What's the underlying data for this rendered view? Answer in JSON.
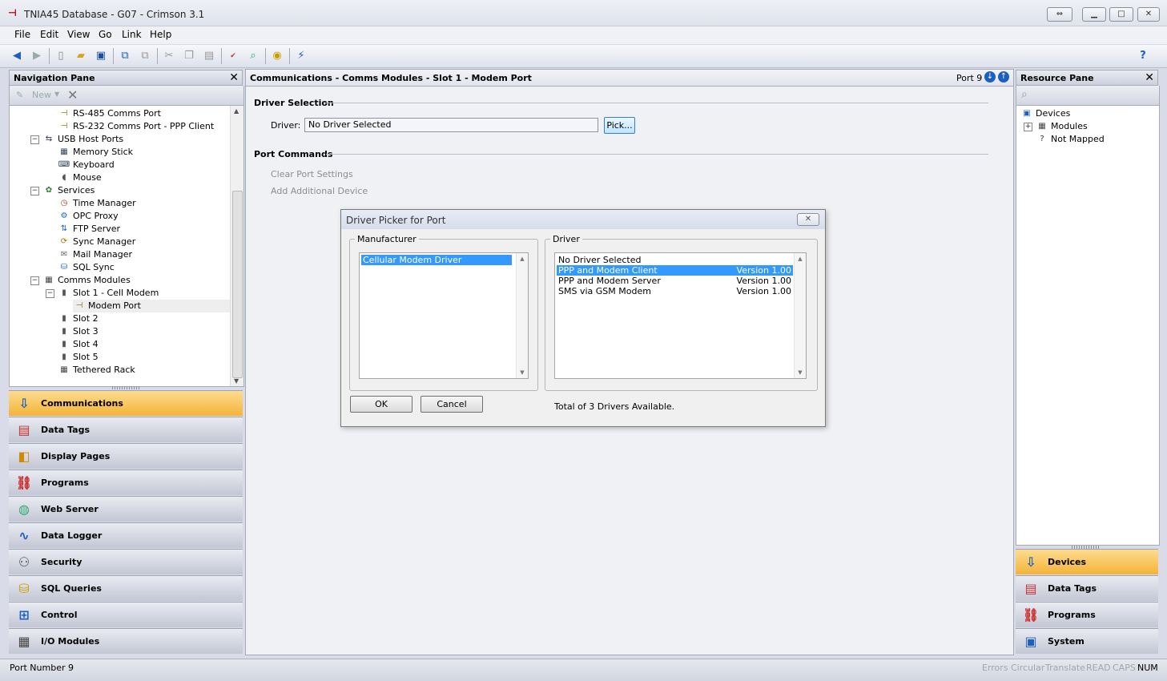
{
  "window": {
    "title": "TNIA45 Database - G07 - Crimson 3.1",
    "app_icon": "crimson-app-icon",
    "buttons": {
      "restore_alt": "⇔",
      "minimize": "▁",
      "maximize": "□",
      "close": "✕"
    }
  },
  "menu": [
    "File",
    "Edit",
    "View",
    "Go",
    "Link",
    "Help"
  ],
  "toolbar": {
    "icons": [
      "back-icon",
      "forward-icon",
      "new-file-icon",
      "open-folder-icon",
      "save-icon",
      "import-icon",
      "export-icon",
      "cut-icon",
      "copy-icon",
      "paste-icon",
      "check-spelling-icon",
      "find-icon",
      "translate-icon",
      "link-icon",
      "help-icon"
    ]
  },
  "nav": {
    "title": "Navigation Pane",
    "new_label": "New",
    "tree": [
      {
        "label": "RS-485 Comms Port",
        "indent": 2,
        "icon": "port"
      },
      {
        "label": "RS-232 Comms Port - PPP Client",
        "indent": 2,
        "icon": "port"
      },
      {
        "label": "USB Host Ports",
        "indent": 1,
        "icon": "usb",
        "exp": "−"
      },
      {
        "label": "Memory Stick",
        "indent": 2,
        "icon": "memory"
      },
      {
        "label": "Keyboard",
        "indent": 2,
        "icon": "keyboard"
      },
      {
        "label": "Mouse",
        "indent": 2,
        "icon": "mouse"
      },
      {
        "label": "Services",
        "indent": 1,
        "icon": "services",
        "exp": "−"
      },
      {
        "label": "Time Manager",
        "indent": 2,
        "icon": "time"
      },
      {
        "label": "OPC Proxy",
        "indent": 2,
        "icon": "opc"
      },
      {
        "label": "FTP Server",
        "indent": 2,
        "icon": "ftp"
      },
      {
        "label": "Sync Manager",
        "indent": 2,
        "icon": "sync"
      },
      {
        "label": "Mail Manager",
        "indent": 2,
        "icon": "mail"
      },
      {
        "label": "SQL Sync",
        "indent": 2,
        "icon": "sql"
      },
      {
        "label": "Comms Modules",
        "indent": 1,
        "icon": "modules",
        "exp": "−"
      },
      {
        "label": "Slot 1 - Cell Modem",
        "indent": 2,
        "icon": "slot",
        "exp": "−"
      },
      {
        "label": "Modem Port",
        "indent": 3,
        "icon": "port",
        "selected": true
      },
      {
        "label": "Slot 2",
        "indent": 2,
        "icon": "slot"
      },
      {
        "label": "Slot 3",
        "indent": 2,
        "icon": "slot"
      },
      {
        "label": "Slot 4",
        "indent": 2,
        "icon": "slot"
      },
      {
        "label": "Slot 5",
        "indent": 2,
        "icon": "slot"
      },
      {
        "label": "Tethered Rack",
        "indent": 2,
        "icon": "rack"
      }
    ],
    "categories": [
      {
        "label": "Communications",
        "active": true,
        "icon": "communications-icon"
      },
      {
        "label": "Data Tags",
        "icon": "data-tags-icon"
      },
      {
        "label": "Display Pages",
        "icon": "display-pages-icon"
      },
      {
        "label": "Programs",
        "icon": "programs-icon"
      },
      {
        "label": "Web Server",
        "icon": "web-server-icon"
      },
      {
        "label": "Data Logger",
        "icon": "data-logger-icon"
      },
      {
        "label": "Security",
        "icon": "security-icon"
      },
      {
        "label": "SQL Queries",
        "icon": "sql-queries-icon"
      },
      {
        "label": "Control",
        "icon": "control-icon"
      },
      {
        "label": "I/O Modules",
        "icon": "io-modules-icon"
      }
    ]
  },
  "main": {
    "header": "Communications - Comms Modules - Slot 1 - Modem Port",
    "port_label": "Port 9",
    "driver_section": "Driver Selection",
    "driver_label": "Driver:",
    "driver_value": "No Driver Selected",
    "pick_button": "Pick...",
    "commands_section": "Port Commands",
    "clear_settings": "Clear Port Settings",
    "add_device": "Add Additional Device"
  },
  "dialog": {
    "title": "Driver Picker for  Port",
    "manufacturer_label": "Manufacturer",
    "manufacturers": [
      {
        "label": "Cellular Modem Driver",
        "selected": true
      }
    ],
    "driver_label": "Driver",
    "drivers": [
      {
        "name": "No Driver Selected",
        "version": ""
      },
      {
        "name": "PPP and Modem Client",
        "version": "Version 1.00",
        "selected": true
      },
      {
        "name": "PPP and Modem Server",
        "version": "Version 1.00"
      },
      {
        "name": "SMS via GSM Modem",
        "version": "Version 1.00"
      }
    ],
    "ok": "OK",
    "cancel": "Cancel",
    "total": "Total of 3 Drivers Available."
  },
  "resource": {
    "title": "Resource Pane",
    "tree": [
      {
        "label": "Devices",
        "indent": 0,
        "icon": "devices"
      },
      {
        "label": "Modules",
        "indent": 1,
        "icon": "modules",
        "exp": "+"
      },
      {
        "label": "Not Mapped",
        "indent": 1,
        "icon": "unknown"
      }
    ],
    "categories": [
      {
        "label": "Devices",
        "active": true,
        "icon": "devices-icon"
      },
      {
        "label": "Data Tags",
        "icon": "data-tags-icon"
      },
      {
        "label": "Programs",
        "icon": "programs-icon"
      },
      {
        "label": "System",
        "icon": "system-icon"
      }
    ]
  },
  "status": {
    "left": "Port Number 9",
    "indicators": [
      {
        "label": "Errors",
        "on": false
      },
      {
        "label": "Circular",
        "on": false
      },
      {
        "label": "Translate",
        "on": false
      },
      {
        "label": "READ",
        "on": false
      },
      {
        "label": "CAPS",
        "on": false
      },
      {
        "label": "NUM",
        "on": true
      }
    ]
  }
}
